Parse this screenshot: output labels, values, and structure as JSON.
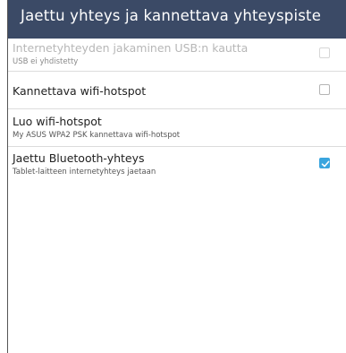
{
  "header": {
    "title": "Jaettu yhteys ja kannettava yhteyspiste"
  },
  "settings": [
    {
      "title": "Internetyhteyden jakaminen USB:n kautta",
      "summary": "USB ei yhdistetty",
      "enabled": false,
      "checked": false
    },
    {
      "title": "Kannettava wifi-hotspot",
      "summary": "",
      "enabled": true,
      "checked": false
    },
    {
      "title": "Luo wifi-hotspot",
      "summary": "My ASUS WPA2 PSK kannettava wifi-hotspot",
      "enabled": true
    },
    {
      "title": "Jaettu Bluetooth-yhteys",
      "summary": "Tablet-laitteen internetyhteys jaetaan",
      "enabled": true,
      "checked": true
    }
  ],
  "colors": {
    "titlebar": "#3b4a66",
    "accent": "#3aa5de"
  }
}
